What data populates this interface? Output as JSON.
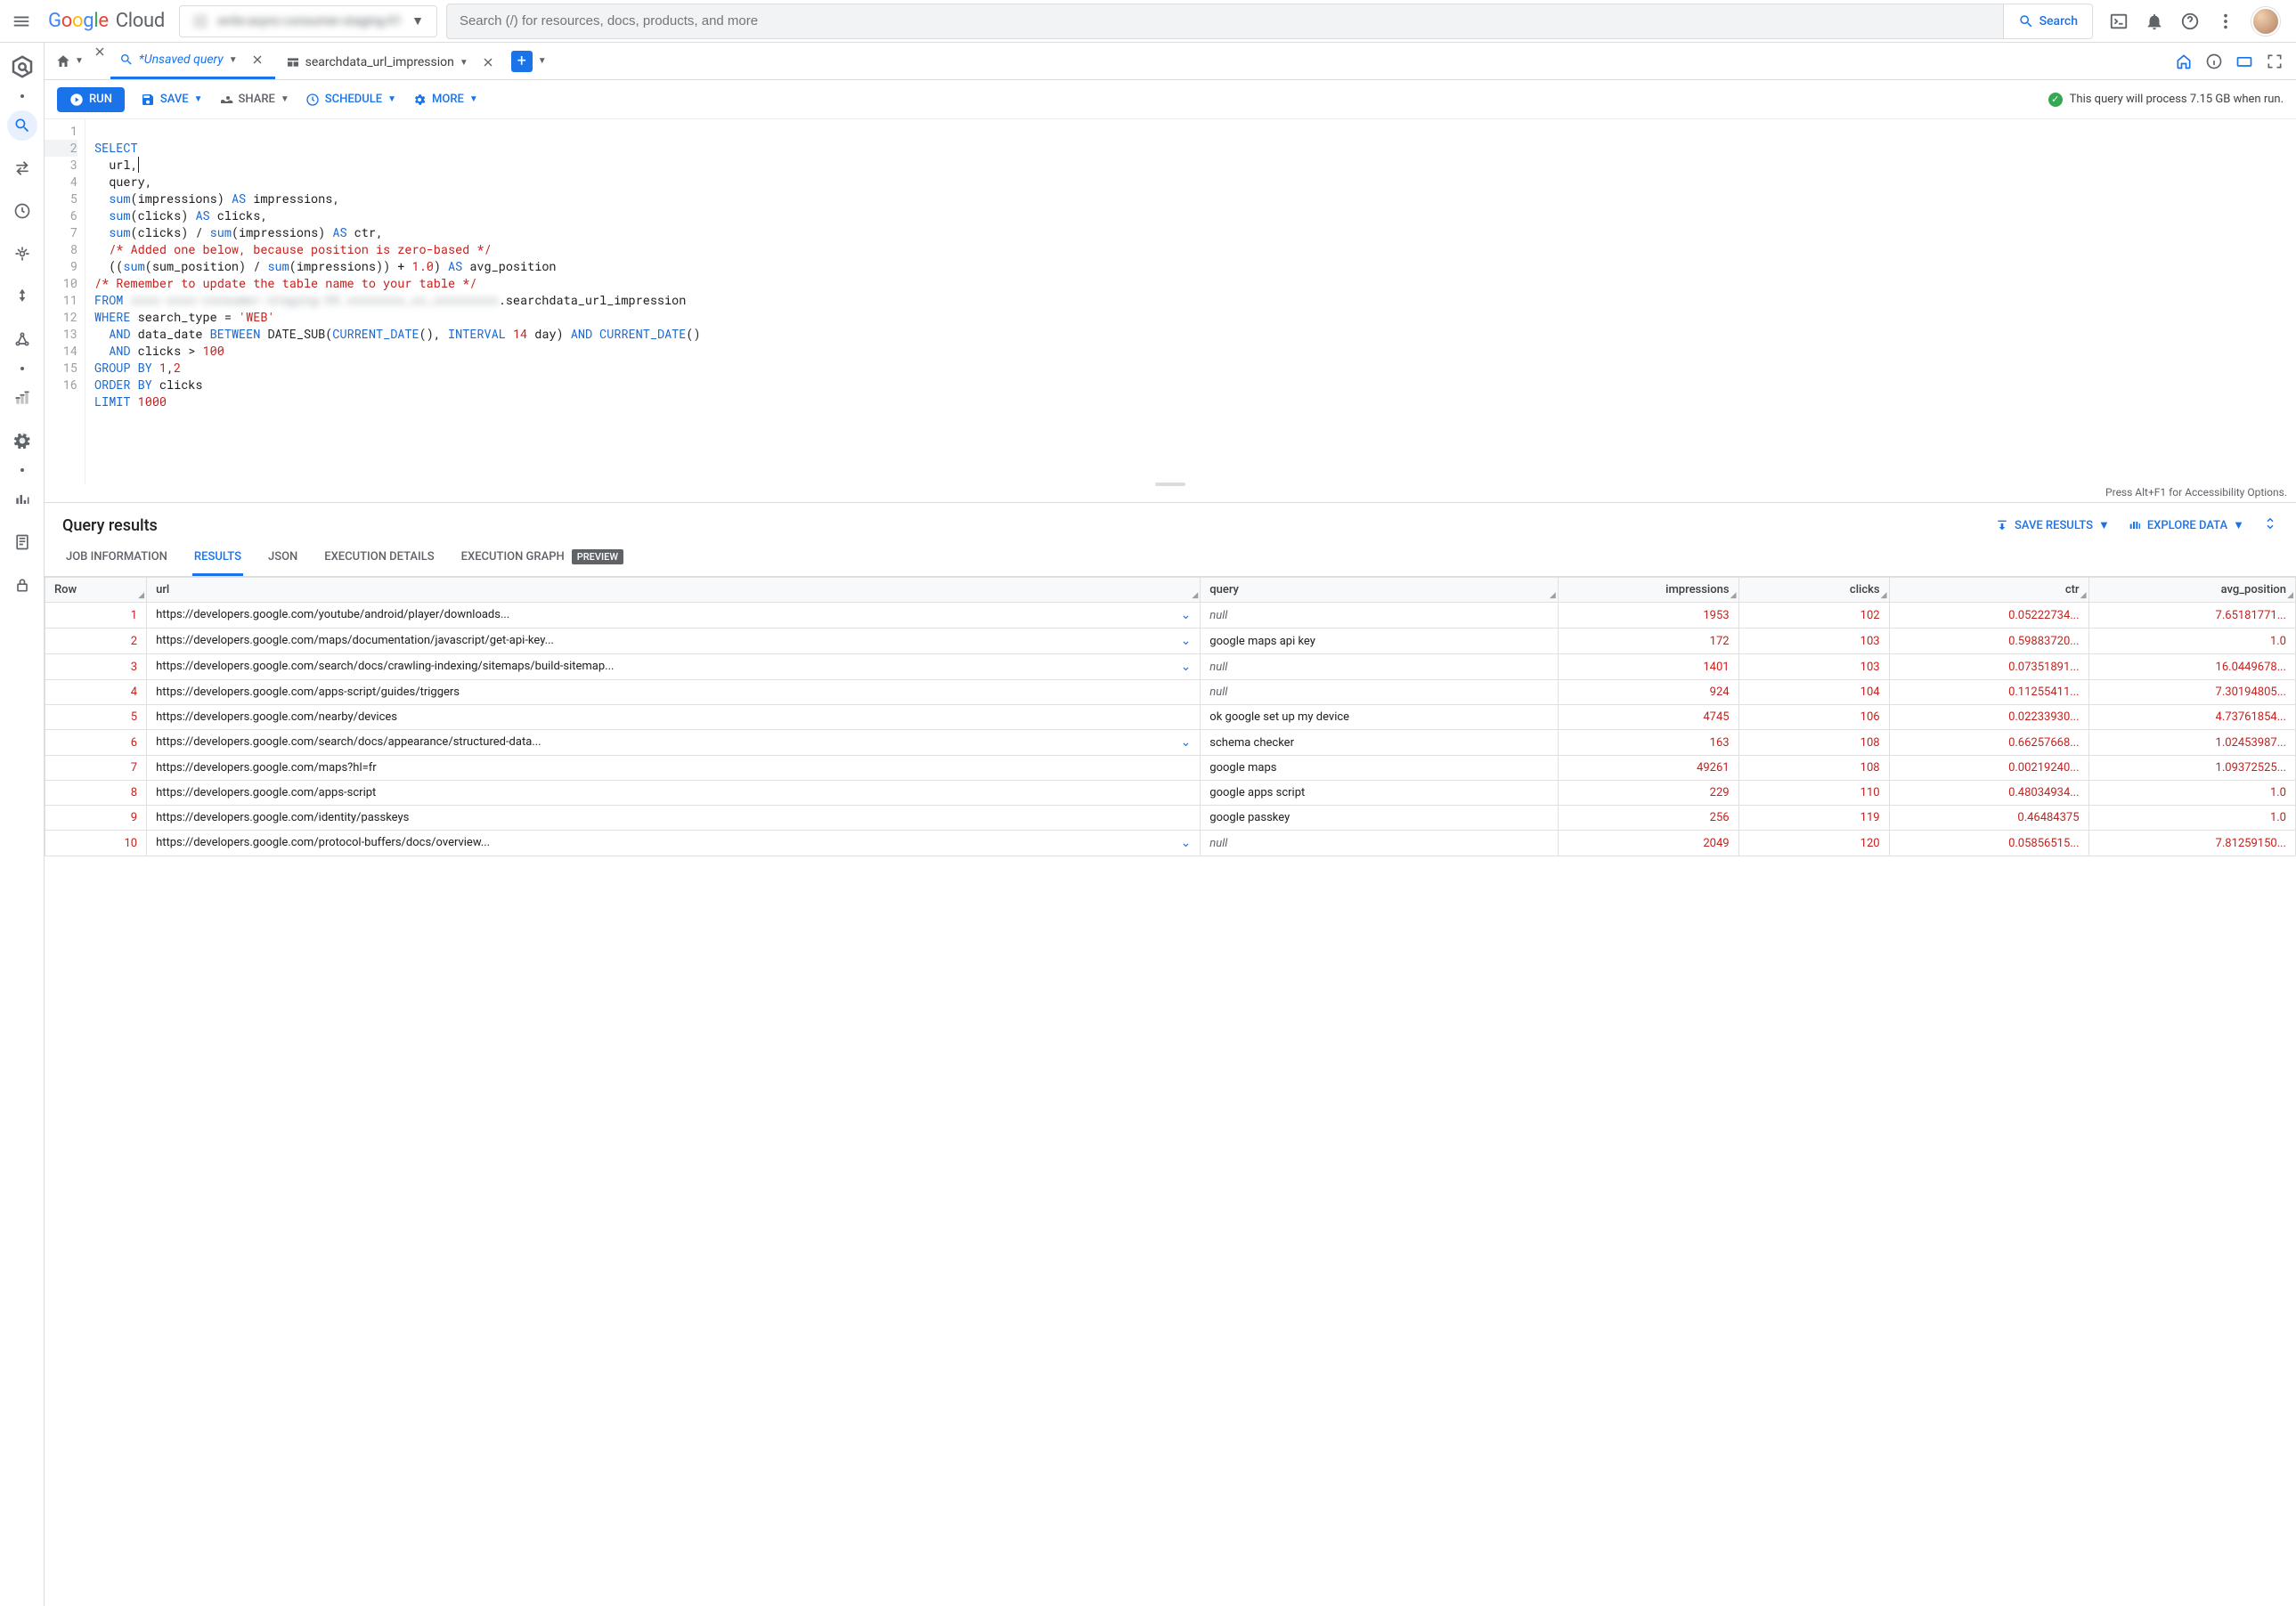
{
  "header": {
    "logo_text_google": "Google",
    "logo_text_cloud": "Cloud",
    "project_name": "write-async-consumer-staging-01",
    "search_placeholder": "Search (/) for resources, docs, products, and more",
    "search_button": "Search"
  },
  "tabs": {
    "unsaved": "*Unsaved query",
    "table_tab": "searchdata_url_impression"
  },
  "toolbar": {
    "run": "RUN",
    "save": "SAVE",
    "share": "SHARE",
    "schedule": "SCHEDULE",
    "more": "MORE",
    "process_msg": "This query will process 7.15 GB when run."
  },
  "sql": {
    "l1": "SELECT",
    "l2": "  url,",
    "l3": "  query,",
    "l4a": "  ",
    "l4b": "sum",
    "l4c": "(impressions) ",
    "l4d": "AS",
    "l4e": " impressions,",
    "l5a": "  ",
    "l5b": "sum",
    "l5c": "(clicks) ",
    "l5d": "AS",
    "l5e": " clicks,",
    "l6a": "  ",
    "l6b": "sum",
    "l6c": "(clicks) / ",
    "l6d": "sum",
    "l6e": "(impressions) ",
    "l6f": "AS",
    "l6g": " ctr,",
    "l7": "  /* Added one below, because position is zero-based */",
    "l8a": "  ((",
    "l8b": "sum",
    "l8c": "(sum_position) / ",
    "l8d": "sum",
    "l8e": "(impressions)) + ",
    "l8f": "1.0",
    "l8g": ") ",
    "l8h": "AS",
    "l8i": " avg_position",
    "l9": "/* Remember to update the table name to your table */",
    "l10a": "FROM ",
    "l10b": "",
    "l10c": ".searchdata_url_impression",
    "l11a": "WHERE",
    "l11b": " search_type = ",
    "l11c": "'WEB'",
    "l12a": "  ",
    "l12b": "AND",
    "l12c": " data_date ",
    "l12d": "BETWEEN",
    "l12e": " DATE_SUB",
    "l12f": "(",
    "l12g": "CURRENT_DATE",
    "l12h": "(), ",
    "l12i": "INTERVAL",
    "l12j": " ",
    "l12k": "14",
    "l12l": " day) ",
    "l12m": "AND",
    "l12n": " ",
    "l12o": "CURRENT_DATE",
    "l12p": "()",
    "l13a": "  ",
    "l13b": "AND",
    "l13c": " clicks > ",
    "l13d": "100",
    "l14a": "GROUP BY",
    "l14b": " ",
    "l14c": "1",
    "l14d": ",",
    "l14e": "2",
    "l15a": "ORDER BY",
    "l15b": " clicks",
    "l16a": "LIMIT",
    "l16b": " ",
    "l16c": "1000"
  },
  "editor_foot": "Press Alt+F1 for Accessibility Options.",
  "results": {
    "title": "Query results",
    "save_results": "SAVE RESULTS",
    "explore_data": "EXPLORE DATA",
    "tabs": {
      "job": "JOB INFORMATION",
      "results": "RESULTS",
      "json": "JSON",
      "exec": "EXECUTION DETAILS",
      "graph": "EXECUTION GRAPH",
      "preview_badge": "PREVIEW"
    },
    "columns": {
      "row": "Row",
      "url": "url",
      "query": "query",
      "impressions": "impressions",
      "clicks": "clicks",
      "ctr": "ctr",
      "avg_position": "avg_position"
    },
    "rows": [
      {
        "n": "1",
        "url": "https://developers.google.com/youtube/android/player/downloads...",
        "chev": true,
        "query": null,
        "imp": "1953",
        "clicks": "102",
        "ctr": "0.05222734...",
        "avg": "7.65181771..."
      },
      {
        "n": "2",
        "url": "https://developers.google.com/maps/documentation/javascript/get-api-key...",
        "chev": true,
        "query": "google maps api key",
        "imp": "172",
        "clicks": "103",
        "ctr": "0.59883720...",
        "avg": "1.0"
      },
      {
        "n": "3",
        "url": "https://developers.google.com/search/docs/crawling-indexing/sitemaps/build-sitemap...",
        "chev": true,
        "query": null,
        "imp": "1401",
        "clicks": "103",
        "ctr": "0.07351891...",
        "avg": "16.0449678..."
      },
      {
        "n": "4",
        "url": "https://developers.google.com/apps-script/guides/triggers",
        "chev": false,
        "query": null,
        "imp": "924",
        "clicks": "104",
        "ctr": "0.11255411...",
        "avg": "7.30194805..."
      },
      {
        "n": "5",
        "url": "https://developers.google.com/nearby/devices",
        "chev": false,
        "query": "ok google set up my device",
        "imp": "4745",
        "clicks": "106",
        "ctr": "0.02233930...",
        "avg": "4.73761854..."
      },
      {
        "n": "6",
        "url": "https://developers.google.com/search/docs/appearance/structured-data...",
        "chev": true,
        "query": "schema checker",
        "imp": "163",
        "clicks": "108",
        "ctr": "0.66257668...",
        "avg": "1.02453987..."
      },
      {
        "n": "7",
        "url": "https://developers.google.com/maps?hl=fr",
        "chev": false,
        "query": "google maps",
        "imp": "49261",
        "clicks": "108",
        "ctr": "0.00219240...",
        "avg": "1.09372525..."
      },
      {
        "n": "8",
        "url": "https://developers.google.com/apps-script",
        "chev": false,
        "query": "google apps script",
        "imp": "229",
        "clicks": "110",
        "ctr": "0.48034934...",
        "avg": "1.0"
      },
      {
        "n": "9",
        "url": "https://developers.google.com/identity/passkeys",
        "chev": false,
        "query": "google passkey",
        "imp": "256",
        "clicks": "119",
        "ctr": "0.46484375",
        "avg": "1.0"
      },
      {
        "n": "10",
        "url": "https://developers.google.com/protocol-buffers/docs/overview...",
        "chev": true,
        "query": null,
        "imp": "2049",
        "clicks": "120",
        "ctr": "0.05856515...",
        "avg": "7.81259150..."
      }
    ]
  }
}
